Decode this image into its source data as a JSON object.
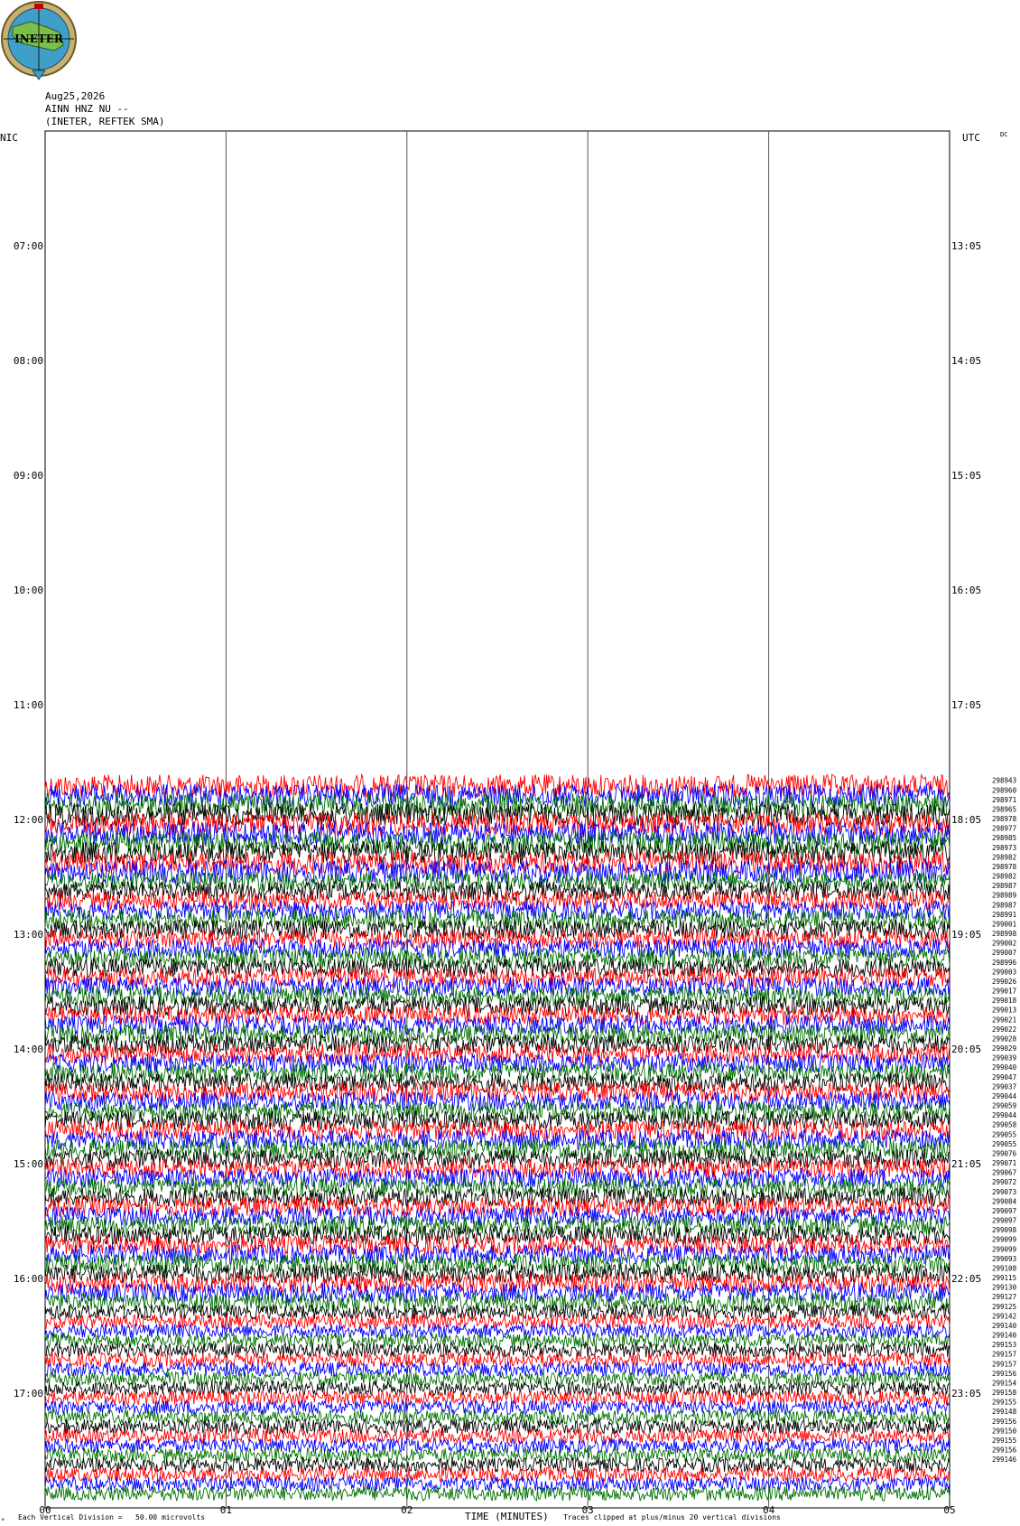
{
  "logo": {
    "text": "INETER"
  },
  "header": {
    "date": "Aug25,2026",
    "channel": "AINN HNZ NU --",
    "network": "(INETER, REFTEK SMA)"
  },
  "zones": {
    "left": "NIC",
    "right": "UTC",
    "corner": "DC"
  },
  "footer": {
    "scale_note": "Each Vertical Division =   50.00 microvolts",
    "xlabel": "TIME (MINUTES)",
    "clip_note": "Traces clipped at plus/minus 20 vertical divisions"
  },
  "colors": {
    "trace_cycle": [
      "#ff0000",
      "#0000ff",
      "#007000",
      "#000000"
    ],
    "grid": "#000000"
  },
  "chart_data": {
    "type": "line",
    "title": "",
    "xlabel": "TIME (MINUTES)",
    "x_ticks": [
      "00",
      "01",
      "02",
      "03",
      "04",
      "05"
    ],
    "x_range": [
      0,
      5
    ],
    "left_hour_labels": [
      "07:00",
      "08:00",
      "09:00",
      "10:00",
      "11:00",
      "12:00",
      "13:00",
      "14:00",
      "15:00",
      "16:00",
      "17:00"
    ],
    "right_hour_labels": [
      "13:05",
      "14:05",
      "15:05",
      "16:05",
      "17:05",
      "18:05",
      "19:05",
      "20:05",
      "21:05",
      "22:05",
      "23:05"
    ],
    "hour_label_rows": [
      12,
      24,
      36,
      48,
      60,
      72,
      84,
      96,
      108,
      120,
      132
    ],
    "total_rows": 144,
    "first_trace_row": 68,
    "trace_count": 75,
    "trace_values": [
      "298943",
      "298960",
      "298971",
      "298965",
      "298978",
      "298977",
      "298985",
      "298973",
      "298982",
      "298978",
      "298982",
      "298987",
      "298989",
      "298987",
      "298991",
      "299001",
      "298998",
      "299002",
      "299007",
      "298996",
      "299003",
      "299026",
      "299017",
      "299018",
      "299013",
      "299021",
      "299022",
      "299028",
      "299029",
      "299039",
      "299040",
      "299047",
      "299037",
      "299044",
      "299059",
      "299044",
      "299058",
      "299055",
      "299055",
      "299076",
      "299071",
      "299067",
      "299072",
      "299073",
      "299084",
      "299097",
      "299097",
      "299098",
      "299099",
      "299099",
      "299093",
      "299108",
      "299115",
      "299130",
      "299127",
      "299125",
      "299142",
      "299140",
      "299140",
      "299153",
      "299157",
      "299157",
      "299156",
      "299154",
      "299158",
      "299155",
      "299148",
      "299156",
      "299150",
      "299155",
      "299156",
      "299146"
    ]
  }
}
